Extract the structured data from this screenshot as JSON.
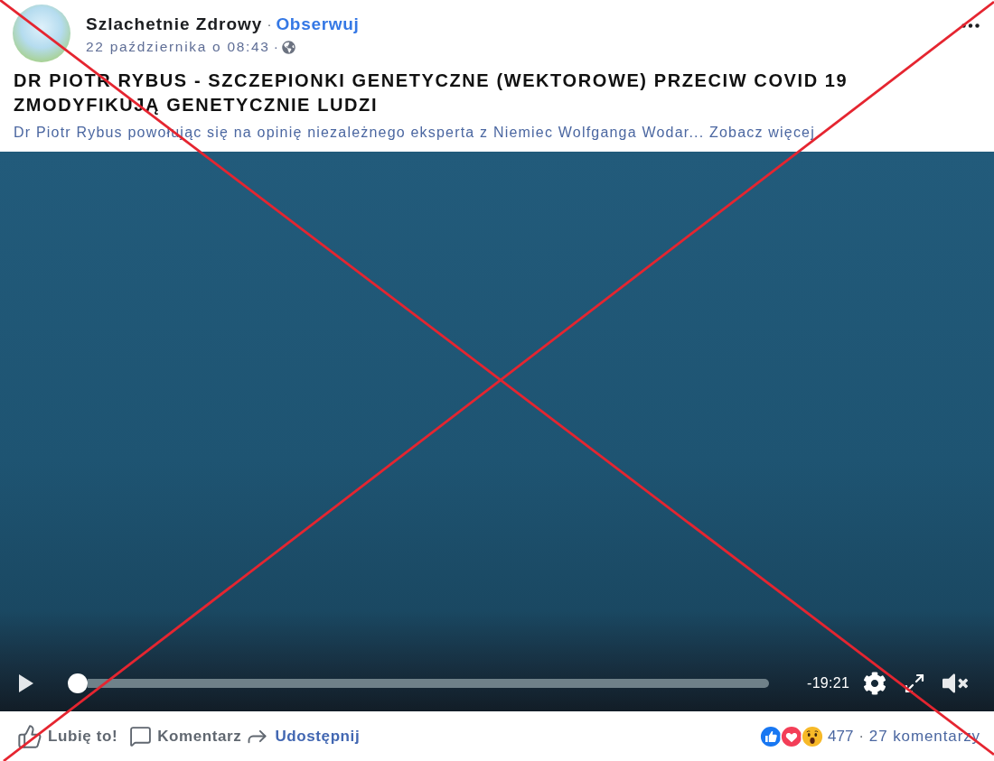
{
  "post": {
    "author": "Szlachetnie Zdrowy",
    "author_separator": "·",
    "follow_link": "Obserwuj",
    "timestamp": "22 października o 08:43",
    "timestamp_separator": "·",
    "title": "DR PIOTR RYBUS - SZCZEPIONKI GENETYCZNE (WEKTOROWE) PRZECIW COVID 19 ZMODYFIKUJĄ GENETYCZNIE LUDZI",
    "description": "Dr Piotr Rybus powołując się na opinię niezależnego eksperta z Niemiec Wolfganga Wodar...",
    "see_more_link": "Zobacz więcej"
  },
  "video": {
    "playing": false,
    "progress": {
      "level": 0
    },
    "time_remaining": "-19:21",
    "muted": true
  },
  "actions": [
    {
      "kind": "like",
      "label": "Lubię to!",
      "highlighted": false
    },
    {
      "kind": "comment",
      "label": "Komentarz",
      "highlighted": false
    },
    {
      "kind": "share",
      "label": "Udostępnij",
      "highlighted": true
    }
  ],
  "reactions": {
    "icons": [
      {
        "kind": "like"
      },
      {
        "kind": "love"
      },
      {
        "kind": "wow"
      }
    ],
    "count": "477",
    "separator": "·",
    "comments": "27 komentarzy"
  }
}
